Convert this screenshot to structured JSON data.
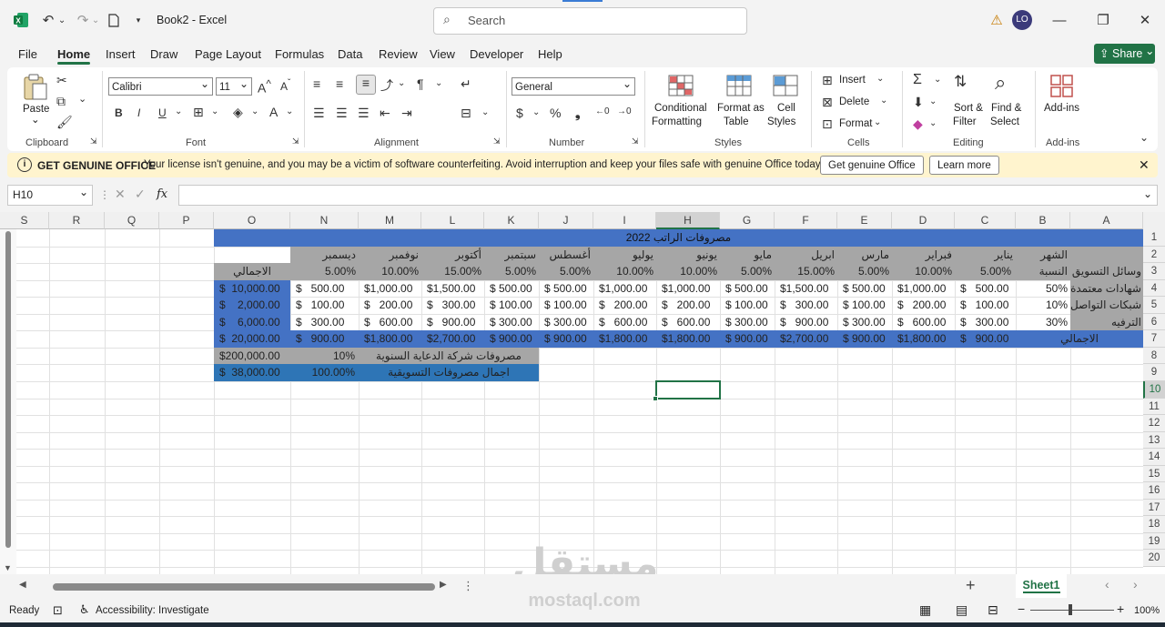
{
  "window": {
    "title": "Book2  -  Excel",
    "search_placeholder": "Search",
    "user_initials": "LO"
  },
  "menu": [
    "File",
    "Home",
    "Insert",
    "Draw",
    "Page Layout",
    "Formulas",
    "Data",
    "Review",
    "View",
    "Developer",
    "Help"
  ],
  "share_label": "Share",
  "ribbon": {
    "clipboard": {
      "paste": "Paste",
      "group": "Clipboard"
    },
    "font": {
      "name": "Calibri",
      "size": "11",
      "group": "Font"
    },
    "alignment": {
      "group": "Alignment"
    },
    "number": {
      "format": "General",
      "group": "Number"
    },
    "styles": {
      "conditional": "Conditional",
      "formatting": "Formatting",
      "format_as": "Format as",
      "table": "Table",
      "cell": "Cell",
      "styles": "Styles",
      "group": "Styles"
    },
    "cells": {
      "insert": "Insert",
      "delete": "Delete",
      "format": "Format",
      "group": "Cells"
    },
    "editing": {
      "sort": "Sort &",
      "filter": "Filter",
      "find": "Find &",
      "select": "Select",
      "group": "Editing"
    },
    "addins": {
      "label": "Add-ins",
      "group": "Add-ins"
    }
  },
  "banner": {
    "title": "GET GENUINE OFFICE",
    "message": "Your license isn't genuine, and you may be a victim of software counterfeiting. Avoid interruption and keep your files safe with genuine Office today.",
    "primary_button": "Get genuine Office",
    "secondary_button": "Learn more"
  },
  "formula_bar": {
    "name_box": "H10",
    "fx": "fx",
    "formula": ""
  },
  "columns": [
    "S",
    "R",
    "Q",
    "P",
    "O",
    "N",
    "M",
    "L",
    "K",
    "J",
    "I",
    "H",
    "G",
    "F",
    "E",
    "D",
    "C",
    "B",
    "A"
  ],
  "rows": [
    "1",
    "2",
    "3",
    "4",
    "5",
    "6",
    "7",
    "8",
    "9",
    "10",
    "11",
    "12",
    "13",
    "14",
    "15",
    "16",
    "17",
    "18",
    "19",
    "20"
  ],
  "sheet": {
    "title_row": "مصروفات  الراتب 2022",
    "months": [
      "يناير",
      "فبراير",
      "مارس",
      "ابريل",
      "مايو",
      "يونيو",
      "يوليو",
      "أغسطس",
      "سبتمبر",
      "أكتوبر",
      "نوفمبر",
      "ديسمبر"
    ],
    "month_header_label": "الشهر",
    "percent_header_label": "النسبة",
    "channel_header_label": "وسائل التسويق",
    "total_header_label": "الاجمالي",
    "month_percents": [
      "5.00%",
      "10.00%",
      "5.00%",
      "15.00%",
      "5.00%",
      "10.00%",
      "10.00%",
      "5.00%",
      "5.00%",
      "15.00%",
      "10.00%",
      "5.00%"
    ],
    "data_rows": [
      {
        "label": "شهادات معتمدة",
        "pct": "50%",
        "values": [
          "$   500.00",
          "$1,000.00",
          "$ 500.00",
          "$1,500.00",
          "$ 500.00",
          "$1,000.00",
          "$1,000.00",
          "$ 500.00",
          "$ 500.00",
          "$1,500.00",
          "$1,000.00",
          "$   500.00"
        ],
        "total": "$  10,000.00"
      },
      {
        "label": "شبكات التواصل",
        "pct": "10%",
        "values": [
          "$   100.00",
          "$   200.00",
          "$ 100.00",
          "$   300.00",
          "$ 100.00",
          "$   200.00",
          "$   200.00",
          "$ 100.00",
          "$ 100.00",
          "$   300.00",
          "$   200.00",
          "$   100.00"
        ],
        "total": "$    2,000.00"
      },
      {
        "label": "الترفيه",
        "pct": "30%",
        "values": [
          "$   300.00",
          "$   600.00",
          "$ 300.00",
          "$   900.00",
          "$ 300.00",
          "$   600.00",
          "$   600.00",
          "$ 300.00",
          "$ 300.00",
          "$   900.00",
          "$   600.00",
          "$   300.00"
        ],
        "total": "$    6,000.00"
      }
    ],
    "totals_label": "الاجمالي",
    "totals": [
      "$   900.00",
      "$1,800.00",
      "$ 900.00",
      "$2,700.00",
      "$ 900.00",
      "$1,800.00",
      "$1,800.00",
      "$ 900.00",
      "$ 900.00",
      "$2,700.00",
      "$1,800.00",
      "$   900.00"
    ],
    "grand_total": "$  20,000.00",
    "annual_label": "مصروفات شركة الدعاية السنوية",
    "annual_pct": "10%",
    "annual_value": "$200,000.00",
    "marketing_label": "اجمال مصروفات التسويقية",
    "marketing_pct": "100.00%",
    "marketing_value": "$  38,000.00"
  },
  "tabs": {
    "sheet1": "Sheet1",
    "add": "+"
  },
  "status": {
    "ready": "Ready",
    "accessibility": "Accessibility: Investigate",
    "zoom": "100%"
  },
  "watermark": {
    "arabic": "مستقل",
    "latin": "mostaql.com"
  },
  "colors": {
    "header_blue": "#4472c4",
    "total_blue": "#4472c4",
    "gray_header": "#a6a6a6",
    "accent_green": "#217346"
  }
}
